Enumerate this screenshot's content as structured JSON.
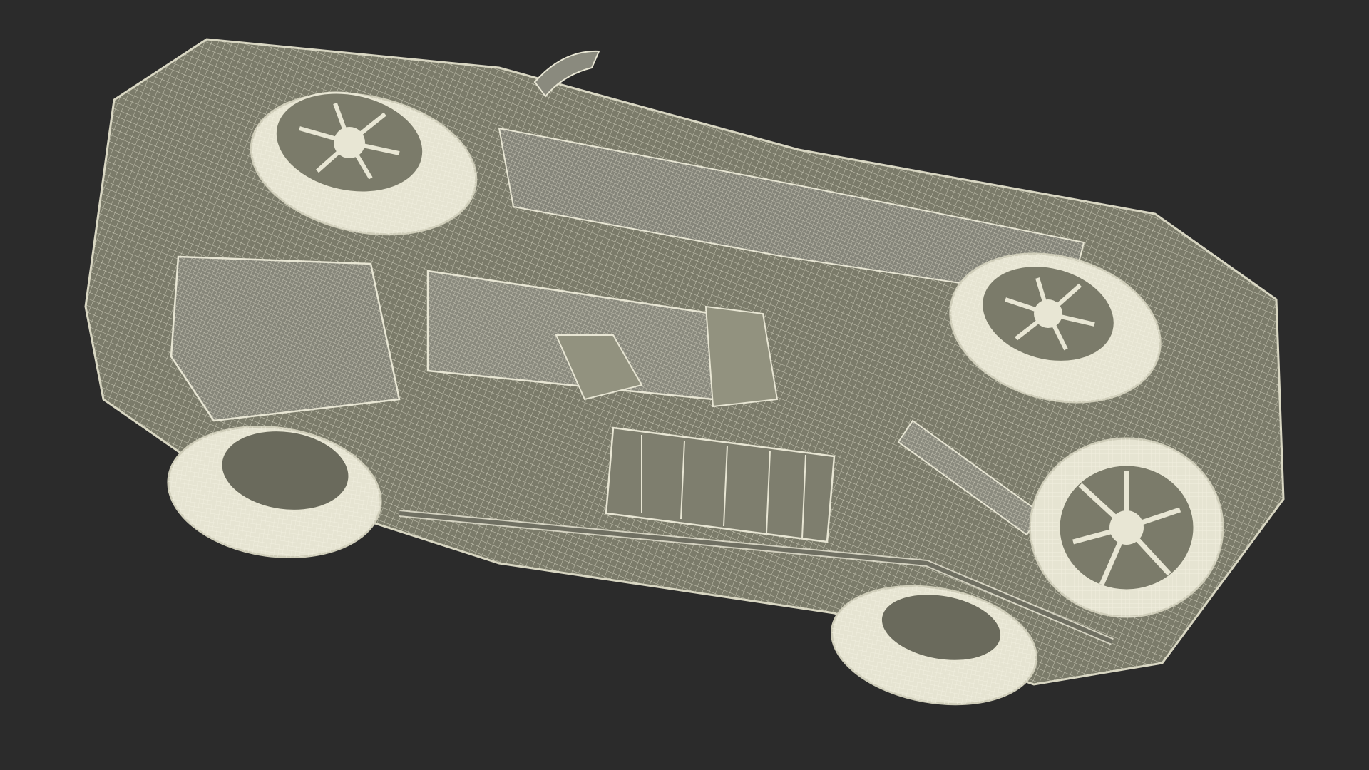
{
  "scene": {
    "subject": "wireframe-render-suv-underside",
    "background_color": "#2b2b2b",
    "model_fill_color": "#7b7b6a",
    "wire_color": "#e8e6d4",
    "tire_color": "#e6e4d2",
    "shadow_color": "#5a5a4e"
  }
}
